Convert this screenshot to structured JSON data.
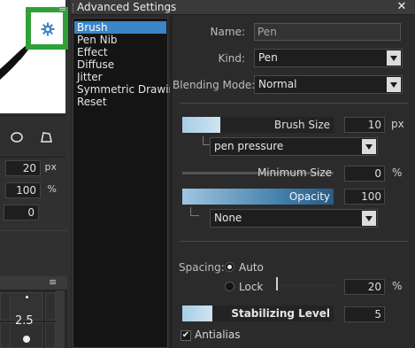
{
  "background_panel": {
    "menu_glyph": "≡",
    "brush_size_value": "20",
    "brush_size_unit": "px",
    "opacity_value": "100",
    "opacity_unit": "%",
    "min_value": "0",
    "grid_menu_glyph": "≡",
    "grid_size_label": "2.5",
    "highlight_color": "#2fa136",
    "gear_icon": "gear-icon"
  },
  "dialog": {
    "title": "Advanced Settings",
    "close_label": "✕"
  },
  "categories": {
    "items": [
      {
        "label": "Brush",
        "selected": true
      },
      {
        "label": "Pen Nib",
        "selected": false
      },
      {
        "label": "Effect",
        "selected": false
      },
      {
        "label": "Diffuse",
        "selected": false
      },
      {
        "label": "Jitter",
        "selected": false
      },
      {
        "label": "Symmetric Drawing",
        "selected": false
      },
      {
        "label": "Reset",
        "selected": false
      }
    ],
    "selected_color": "#3a86c8"
  },
  "settings": {
    "name_label": "Name:",
    "name_value": "Pen",
    "kind_label": "Kind:",
    "kind_value": "Pen",
    "blending_label": "Blending Mode:",
    "blending_value": "Normal",
    "brush_size": {
      "label": "Brush Size",
      "value": "10",
      "unit": "px",
      "fill_fraction": 0.25
    },
    "pressure_value": "pen pressure",
    "minimum_size": {
      "label": "Minimum Size",
      "value": "0",
      "unit": "%",
      "fill_fraction": 0.0
    },
    "opacity": {
      "label": "Opacity",
      "value": "100",
      "fill_fraction": 1.0
    },
    "opacity_source_value": "None",
    "spacing_label": "Spacing:",
    "spacing_auto_label": "Auto",
    "spacing_lock_label": "Lock",
    "spacing_mode": "Auto",
    "spacing_value": "20",
    "spacing_unit": "%",
    "stabilizing": {
      "label": "Stabilizing Level",
      "value": "5",
      "fill_fraction": 0.2
    },
    "antialias_label": "Antialias",
    "antialias_checked": true,
    "check_glyph": "✔"
  }
}
